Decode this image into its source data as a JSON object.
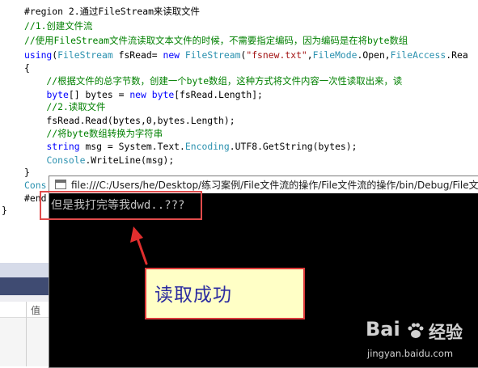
{
  "editor": {
    "lines": [
      [
        {
          "t": "#region 2.通过FileStream来读取文件",
          "c": "pl"
        }
      ],
      [
        {
          "t": "//1.创建文件流",
          "c": "cm"
        }
      ],
      [
        {
          "t": "//使用FileStream文件流读取文本文件的时候，不需要指定编码，因为编码是在将byte数组",
          "c": "cm"
        }
      ],
      [
        {
          "t": "using",
          "c": "kw"
        },
        {
          "t": "(",
          "c": "pl"
        },
        {
          "t": "FileStream",
          "c": "tp"
        },
        {
          "t": " fsRead= ",
          "c": "pl"
        },
        {
          "t": "new",
          "c": "kw"
        },
        {
          "t": " ",
          "c": "pl"
        },
        {
          "t": "FileStream",
          "c": "tp"
        },
        {
          "t": "(",
          "c": "pl"
        },
        {
          "t": "\"fsnew.txt\"",
          "c": "st"
        },
        {
          "t": ",",
          "c": "pl"
        },
        {
          "t": "FileMode",
          "c": "tp"
        },
        {
          "t": ".Open,",
          "c": "pl"
        },
        {
          "t": "FileAccess",
          "c": "tp"
        },
        {
          "t": ".Rea",
          "c": "pl"
        }
      ],
      [
        {
          "t": "{",
          "c": "pl"
        }
      ],
      [
        {
          "t": "    //根据文件的总字节数，创建一个byte数组，这种方式将文件内容一次性读取出来，读",
          "c": "cm"
        }
      ],
      [
        {
          "t": "    ",
          "c": "pl"
        },
        {
          "t": "byte",
          "c": "kw"
        },
        {
          "t": "[] bytes = ",
          "c": "pl"
        },
        {
          "t": "new",
          "c": "kw"
        },
        {
          "t": " ",
          "c": "pl"
        },
        {
          "t": "byte",
          "c": "kw"
        },
        {
          "t": "[fsRead.Length];",
          "c": "pl"
        }
      ],
      [
        {
          "t": "    //2.读取文件",
          "c": "cm"
        }
      ],
      [
        {
          "t": "    fsRead.Read(bytes,0,bytes.Length);",
          "c": "pl"
        }
      ],
      [
        {
          "t": "    //将byte数组转换为字符串",
          "c": "cm"
        }
      ],
      [
        {
          "t": "    ",
          "c": "pl"
        },
        {
          "t": "string",
          "c": "kw"
        },
        {
          "t": " msg = System.Text.",
          "c": "pl"
        },
        {
          "t": "Encoding",
          "c": "tp"
        },
        {
          "t": ".UTF8.GetString(bytes);",
          "c": "pl"
        }
      ],
      [
        {
          "t": "    ",
          "c": "pl"
        },
        {
          "t": "Console",
          "c": "tp"
        },
        {
          "t": ".WriteLine(msg);",
          "c": "pl"
        }
      ],
      [
        {
          "t": "}",
          "c": "pl"
        }
      ],
      [
        {
          "t": "Cons",
          "c": "tp"
        }
      ],
      [
        {
          "t": "#end",
          "c": "pl"
        }
      ],
      [
        {
          "t": "}",
          "c": "pl"
        }
      ]
    ]
  },
  "panel": {
    "column_header": "值"
  },
  "console": {
    "title": "file:///C:/Users/he/Desktop/练习案例/File文件流的操作/File文件流的操作/bin/Debug/File文",
    "output": "但是我打完等我dwd..???"
  },
  "callout": {
    "text": "读取成功"
  },
  "watermark": {
    "logo": "Bai",
    "site": "经验",
    "url": "jingyan.baidu.com"
  },
  "colors": {
    "keyword": "#0000ff",
    "type": "#2b91af",
    "comment": "#008000",
    "string": "#a31515",
    "annotation_red": "#e14b4b",
    "callout_bg": "#ffffc6",
    "callout_text": "#2c2ca0"
  },
  "icons": {
    "console_app": "console-window-icon",
    "arrow": "red-arrow-icon",
    "watermark": "baidu-paw-icon"
  }
}
